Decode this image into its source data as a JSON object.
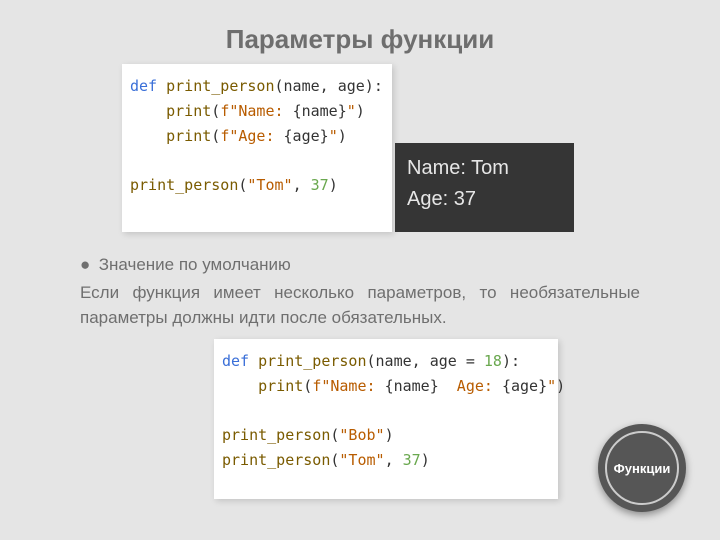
{
  "title": "Параметры функции",
  "code1": {
    "l1": {
      "kw": "def",
      "fn": " print_person",
      "rest": "(name, age):"
    },
    "l2": {
      "indent": "    ",
      "call": "print",
      "open": "(",
      "strp": "f\"Name: ",
      "inside": "{name}",
      "strs": "\"",
      "close": ")"
    },
    "l3": {
      "indent": "    ",
      "call": "print",
      "open": "(",
      "strp": "f\"Age: ",
      "inside": "{age}",
      "strs": "\"",
      "close": ")"
    },
    "blank": "",
    "l5": {
      "fn": "print_person",
      "open": "(",
      "str": "\"Tom\"",
      "comma": ", ",
      "num": "37",
      "close": ")"
    }
  },
  "output1": {
    "l1": "Name: Tom",
    "l2": "Age: 37"
  },
  "bullet": "Значение по умолчанию",
  "paragraph": "Если функция имеет несколько параметров, то необязательные параметры должны идти после обязательных.",
  "code2": {
    "l1": {
      "kw": "def",
      "fn": " print_person",
      "rest": "(name, age = ",
      "num": "18",
      "rest2": "):"
    },
    "l2": {
      "indent": "    ",
      "call": "print",
      "open": "(",
      "strp": "f\"Name: ",
      "ins1": "{name}",
      "mid": "  Age: ",
      "ins2": "{age}",
      "strs": "\"",
      "close": ")"
    },
    "blank": "",
    "l4": {
      "fn": "print_person",
      "open": "(",
      "str": "\"Bob\"",
      "close": ")"
    },
    "l5": {
      "fn": "print_person",
      "open": "(",
      "str": "\"Tom\"",
      "comma": ", ",
      "num": "37",
      "close": ")"
    }
  },
  "badge": "Функции"
}
